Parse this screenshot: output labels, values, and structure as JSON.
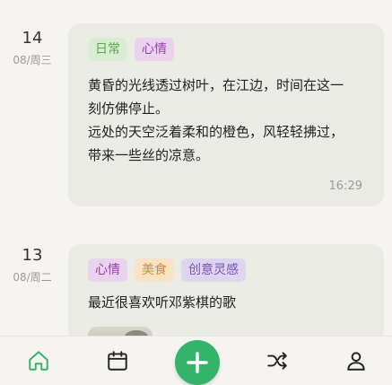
{
  "entries": [
    {
      "day": "14",
      "date": "08/周三",
      "tags": [
        "日常",
        "心情"
      ],
      "lines": [
        "黄昏的光线透过树叶，在江边，时间在这一",
        "刻仿佛停止。",
        "远处的天空泛着柔和的橙色，风轻轻拂过，",
        "带来一些丝的凉意。"
      ],
      "time": "16:29"
    },
    {
      "day": "13",
      "date": "08/周二",
      "tags": [
        "心情",
        "美食",
        "创意灵感"
      ],
      "lines": [
        "最近很喜欢听邓紫棋的歌"
      ]
    }
  ],
  "tag_colors": {
    "日常": {
      "bg": "#d9edd2",
      "fg": "#5aaa4a"
    },
    "心情": {
      "bg": "#ead3ee",
      "fg": "#9b3fae"
    },
    "美食": {
      "bg": "#f7e2c8",
      "fg": "#d98a2b"
    },
    "创意灵感": {
      "bg": "#ded6ee",
      "fg": "#7a52b5"
    }
  },
  "nav": {
    "items": [
      "home-icon",
      "calendar-icon",
      "add-icon",
      "shuffle-icon",
      "profile-icon"
    ],
    "active": "home-icon",
    "active_color": "#35b36a",
    "icon_color": "#222222"
  }
}
